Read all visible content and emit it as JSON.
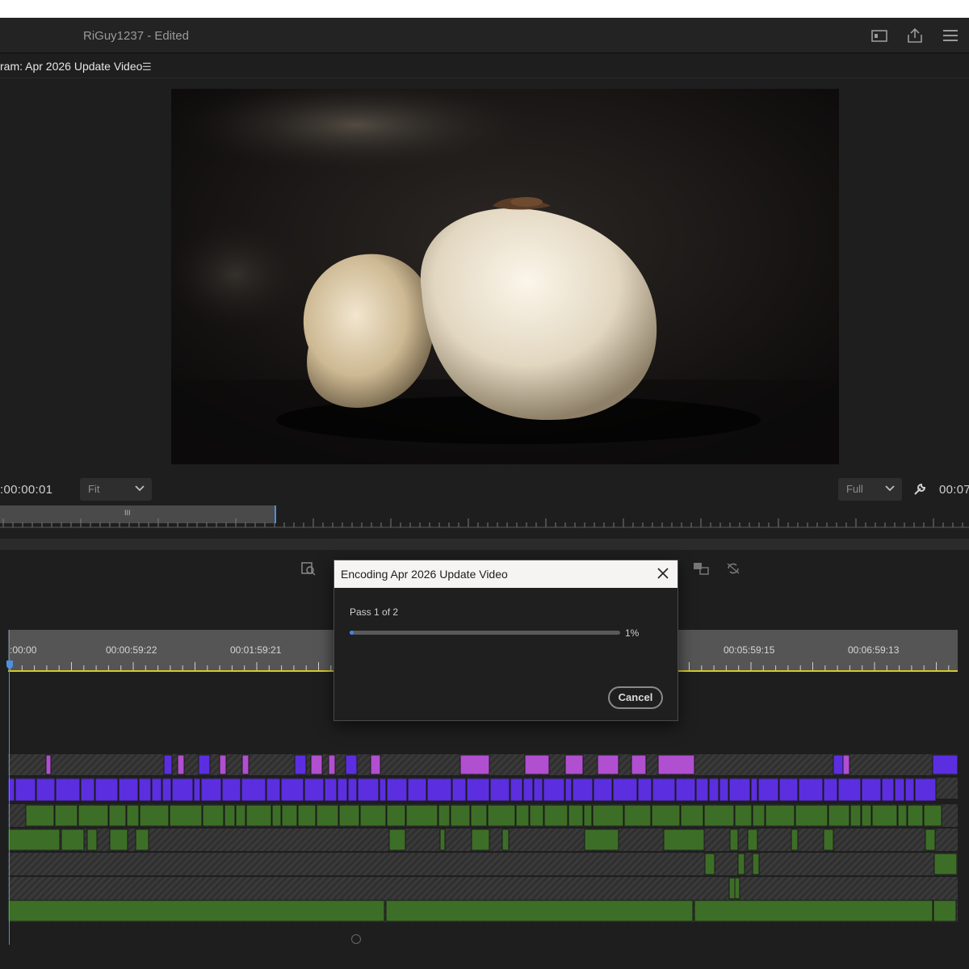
{
  "window": {
    "title": "RiGuy1237  - Edited"
  },
  "program_panel": {
    "title": "ram: Apr 2026 Update Video",
    "timecode_left": ":00:00:01",
    "zoom_select": "Fit",
    "quality_select": "Full",
    "timecode_right": "00:07"
  },
  "timeline": {
    "ruler_labels": [
      ":00:00",
      "00:00:59:22",
      "00:01:59:21",
      "00:05:59:15",
      "00:06:59:13"
    ]
  },
  "encode_dialog": {
    "title": "Encoding Apr 2026 Update Video",
    "pass_label": "Pass 1 of 2",
    "progress_percent": 1,
    "progress_text": "1%",
    "cancel_label": "Cancel"
  },
  "colors": {
    "accent": "#3f86ef",
    "video_clip": "#5b2ee0",
    "pink_clip": "#b04fd0",
    "audio_clip": "#3d6e27",
    "playhead": "#4d8fe0",
    "work_area": "#d4c92a"
  }
}
